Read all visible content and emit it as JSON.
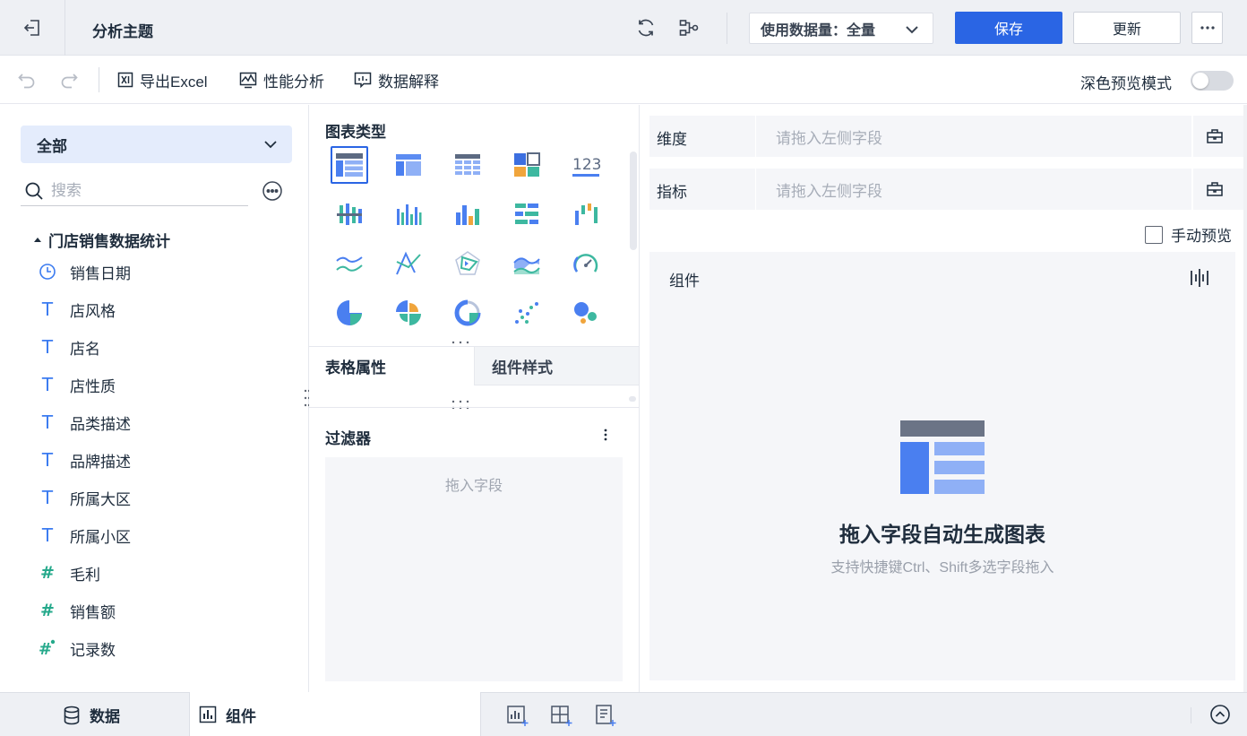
{
  "header": {
    "title": "分析主题",
    "data_usage": "使用数据量：全量",
    "save_label": "保存",
    "update_label": "更新"
  },
  "toolbar": {
    "export_label": "导出Excel",
    "perf_label": "性能分析",
    "explain_label": "数据解释",
    "dark_preview_label": "深色预览模式",
    "dark_preview_on": false
  },
  "left": {
    "scope": "全部",
    "search_placeholder": "搜索",
    "group": "门店销售数据统计",
    "fields": [
      {
        "label": "销售日期",
        "type": "date"
      },
      {
        "label": "店风格",
        "type": "text"
      },
      {
        "label": "店名",
        "type": "text"
      },
      {
        "label": "店性质",
        "type": "text"
      },
      {
        "label": "品类描述",
        "type": "text"
      },
      {
        "label": "品牌描述",
        "type": "text"
      },
      {
        "label": "所属大区",
        "type": "text"
      },
      {
        "label": "所属小区",
        "type": "text"
      },
      {
        "label": "毛利",
        "type": "number"
      },
      {
        "label": "销售额",
        "type": "number"
      },
      {
        "label": "记录数",
        "type": "calc-number"
      }
    ]
  },
  "middle": {
    "chart_type_title": "图表类型",
    "tab_table_props": "表格属性",
    "tab_component_style": "组件样式",
    "filter_title": "过滤器",
    "filter_drop_hint": "拖入字段"
  },
  "right": {
    "dimension_label": "维度",
    "metric_label": "指标",
    "drop_placeholder": "请拖入左侧字段",
    "manual_preview_label": "手动预览",
    "manual_preview_checked": false,
    "component_label": "组件",
    "empty_title": "拖入字段自动生成图表",
    "empty_hint": "支持快捷键Ctrl、Shift多选字段拖入"
  },
  "bottom": {
    "data_tab": "数据",
    "component_tab": "组件"
  },
  "colors": {
    "primary": "#2a65e4",
    "text_field": "#3b7bf0",
    "number_field": "#25a98b"
  }
}
